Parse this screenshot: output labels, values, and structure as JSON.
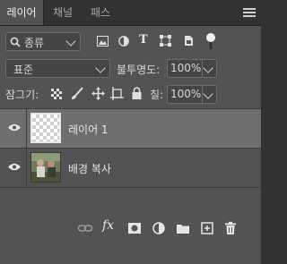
{
  "tabs": [
    {
      "label": "레이어",
      "active": true
    },
    {
      "label": "채널",
      "active": false
    },
    {
      "label": "패스",
      "active": false
    }
  ],
  "filter": {
    "kind_label": "종류"
  },
  "blend": {
    "mode": "표준",
    "opacity_label": "불투명도:",
    "opacity_value": "100%"
  },
  "lock": {
    "label": "잠그기:",
    "fill_label": "칠:",
    "fill_value": "100%"
  },
  "layers": [
    {
      "name": "레이어 1",
      "selected": true,
      "visible": true
    },
    {
      "name": "배경 복사",
      "selected": false,
      "visible": true
    }
  ],
  "bottom_icons": [
    "link-icon",
    "fx-icon",
    "mask-icon",
    "adjustment-icon",
    "folder-icon",
    "new-layer-icon",
    "trash-icon"
  ],
  "colors": {
    "panel_bg": "#535353",
    "selected_row": "#6e6e6e",
    "tab_bar": "#323232"
  }
}
